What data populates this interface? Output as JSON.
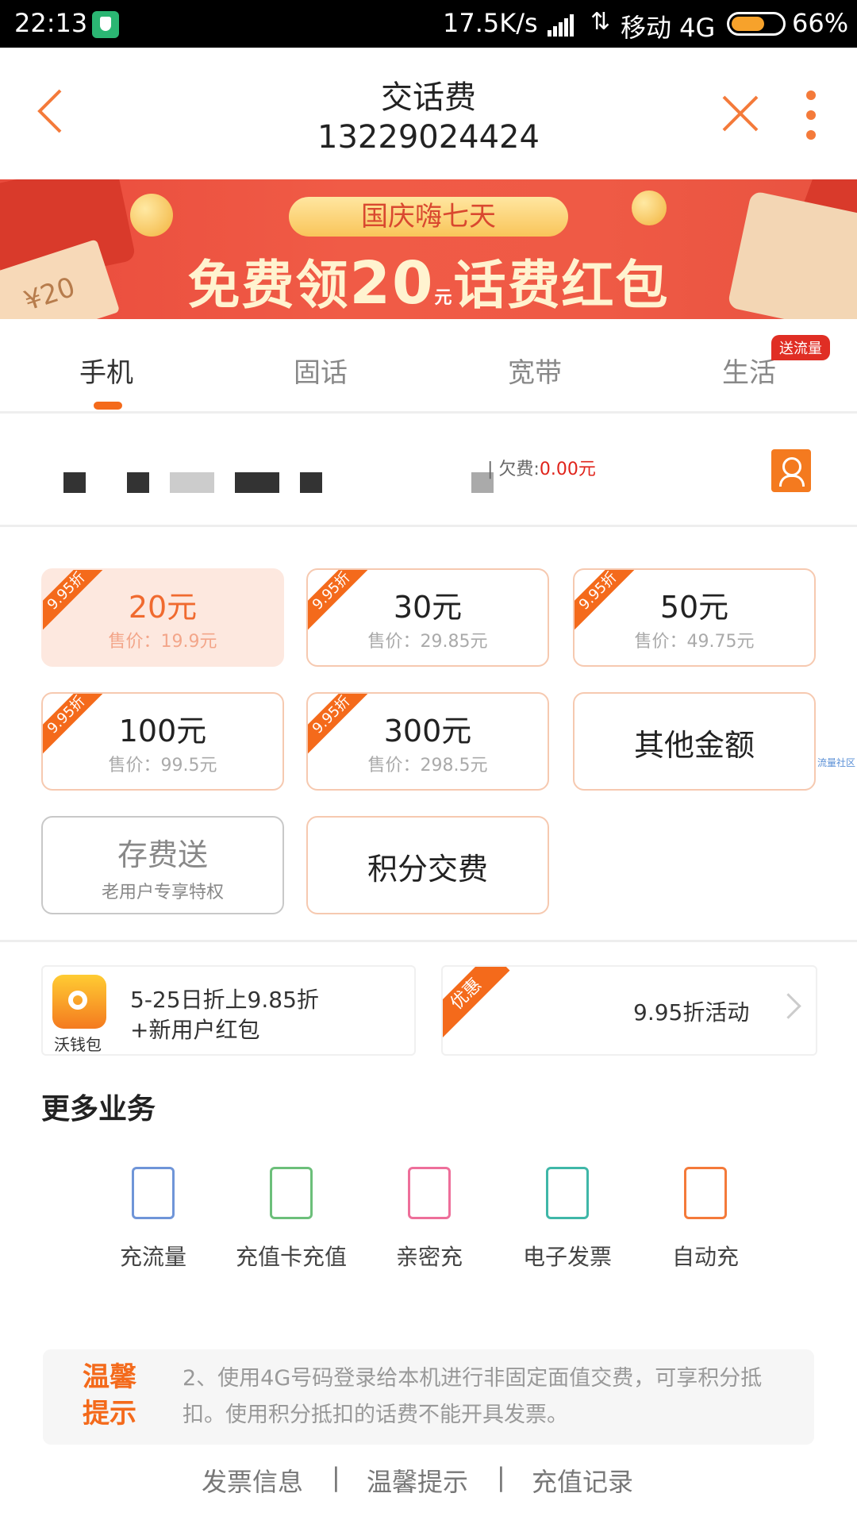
{
  "status_bar": {
    "time": "22:13",
    "speed": "17.5K/s",
    "carrier": "移动 4G",
    "battery_percent": "66%",
    "battery_level": 0.66
  },
  "header": {
    "title": "交话费",
    "phone": "13229024424"
  },
  "banner": {
    "pill": "国庆嗨七天",
    "headline_pre": "免费领",
    "headline_num": "20",
    "headline_unit": "元",
    "headline_post": "话费红包",
    "coupon": "¥20"
  },
  "tabs": [
    {
      "label": "手机",
      "active": true
    },
    {
      "label": "固话",
      "active": false
    },
    {
      "label": "宽带",
      "active": false
    },
    {
      "label": "生活",
      "active": false
    }
  ],
  "tab_badge": "送流量",
  "account": {
    "owe_label": "| 欠费:",
    "owe_amount": "0.00元"
  },
  "amounts": [
    {
      "amount": "20元",
      "price": "售价：19.9元",
      "ribbon": "9.95折",
      "selected": true
    },
    {
      "amount": "30元",
      "price": "售价：29.85元",
      "ribbon": "9.95折"
    },
    {
      "amount": "50元",
      "price": "售价：49.75元",
      "ribbon": "9.95折"
    },
    {
      "amount": "100元",
      "price": "售价：99.5元",
      "ribbon": "9.95折"
    },
    {
      "amount": "300元",
      "price": "售价：298.5元",
      "ribbon": "9.95折"
    },
    {
      "label": "其他金额"
    },
    {
      "label": "存费送",
      "sub": "老用户专享特权"
    },
    {
      "label": "积分交费"
    }
  ],
  "side_tag": "流量社区",
  "promo": {
    "wallet_label": "沃钱包",
    "line1": "5-25日折上9.85折",
    "line2": "+新用户红包",
    "ribbon": "优惠",
    "right_text": "9.95折活动"
  },
  "more_services": {
    "title": "更多业务",
    "items": [
      {
        "label": "充流量",
        "icon": "data-4g-icon",
        "color": "#6f95d8"
      },
      {
        "label": "充值卡充值",
        "icon": "recharge-card-icon",
        "color": "#6cbf7a"
      },
      {
        "label": "亲密充",
        "icon": "heart-phone-icon",
        "color": "#ee6f9a"
      },
      {
        "label": "电子发票",
        "icon": "invoice-icon",
        "color": "#3fb7a8"
      },
      {
        "label": "自动充",
        "icon": "auto-charge-icon",
        "color": "#f47a3a"
      }
    ]
  },
  "tips": {
    "head": "温馨提示",
    "body": "2、使用4G号码登录给本机进行非固定面值交费，可享积分抵扣。使用积分抵扣的话费不能开具发票。"
  },
  "footer": [
    "发票信息",
    "|",
    "温馨提示",
    "|",
    "充值记录"
  ],
  "colors": {
    "accent": "#f46a1b",
    "red": "#e0241b",
    "banner": "#ef5a45"
  }
}
